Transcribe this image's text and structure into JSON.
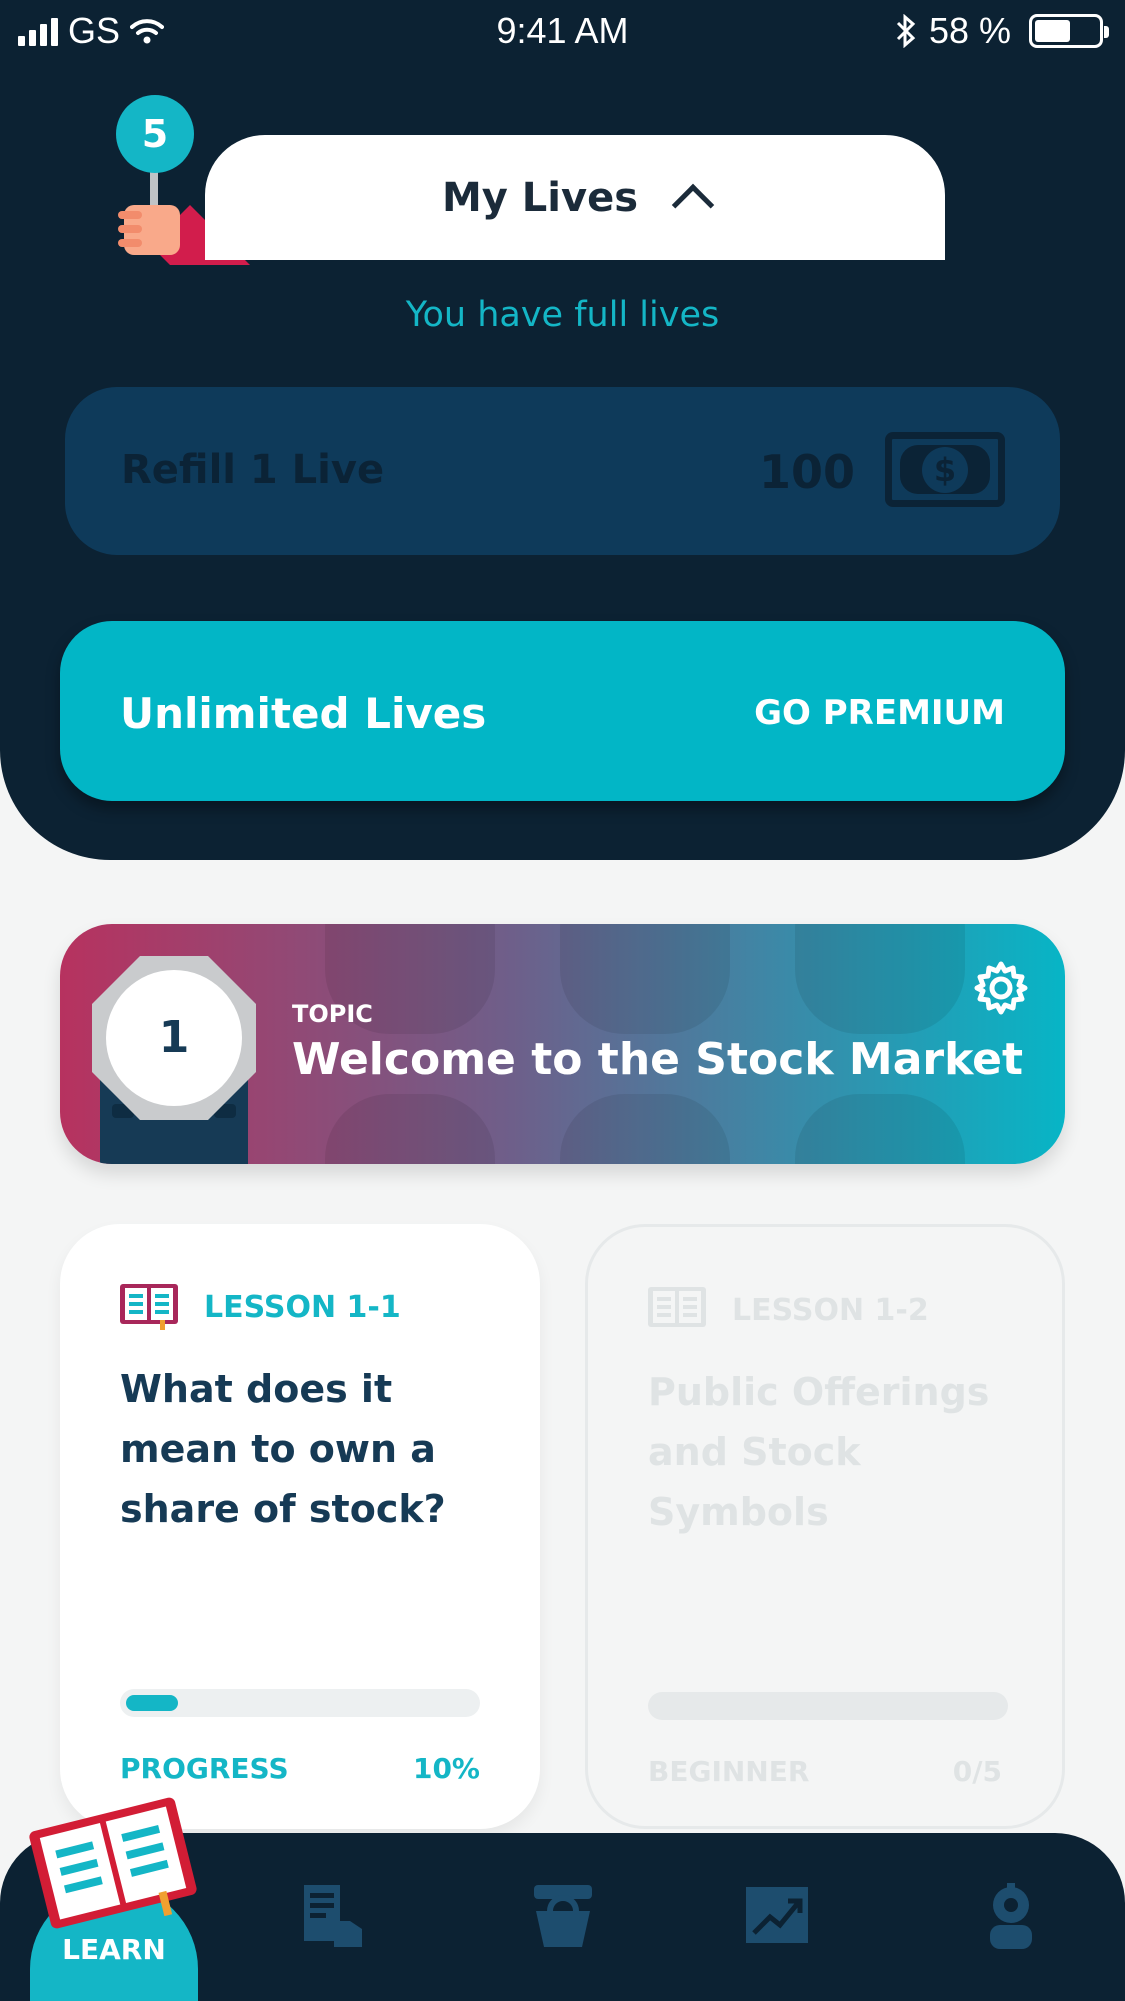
{
  "status_bar": {
    "carrier": "GS",
    "time": "9:41 AM",
    "battery": "58 %",
    "battery_level": 0.58
  },
  "lives": {
    "count": "5",
    "title": "My Lives",
    "status": "You have full lives",
    "refill": {
      "label": "Refill 1 Live",
      "price": "100",
      "currency_icon": "dollar-bill-icon"
    },
    "premium": {
      "label": "Unlimited Lives",
      "cta": "GO PREMIUM"
    }
  },
  "topic": {
    "number": "1",
    "eyebrow": "TOPIC",
    "name": "Welcome to the Stock Market"
  },
  "lessons": [
    {
      "number": "LESSON 1-1",
      "title": "What does it mean to own a share of stock?",
      "footer_left": "PROGRESS",
      "footer_right": "10%",
      "progress": 0.1
    },
    {
      "number": "LESSON 1-2",
      "title": "Public Offerings and Stock Symbols",
      "footer_left": "BEGINNER",
      "footer_right": "0/5",
      "progress": 0
    }
  ],
  "nav": {
    "active_label": "LEARN",
    "tabs": [
      "learn-book-icon",
      "practice-icon",
      "shop-icon",
      "portfolio-chart-icon",
      "settings-gear-icon"
    ]
  },
  "colors": {
    "navy": "#0c2233",
    "teal": "#02b6c6",
    "crimson": "#b7325f"
  }
}
